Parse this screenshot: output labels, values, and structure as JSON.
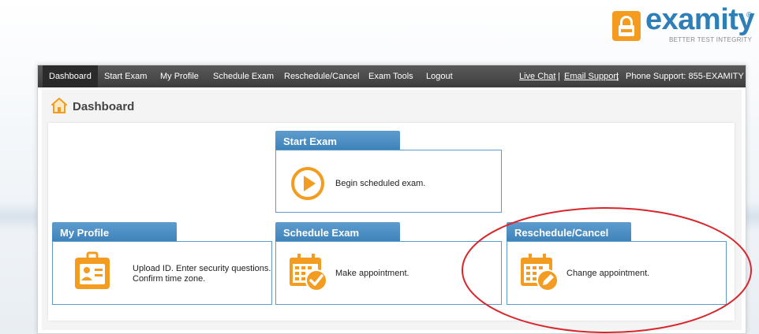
{
  "logo": {
    "name": "examity",
    "reg": "®",
    "tagline": "BETTER TEST INTEGRITY"
  },
  "nav": {
    "items": [
      "Dashboard",
      "Start Exam",
      "My Profile",
      "Schedule Exam",
      "Reschedule/Cancel",
      "Exam Tools",
      "Logout"
    ],
    "active": "Dashboard",
    "live_chat": "Live Chat",
    "email_support": "Email Support",
    "separator": "|",
    "phone": "Phone Support: 855-EXAMITY"
  },
  "page": {
    "title": "Dashboard"
  },
  "cards": {
    "start_exam": {
      "title": "Start Exam",
      "text": "Begin scheduled exam.",
      "icon": "play-icon"
    },
    "my_profile": {
      "title": "My Profile",
      "text_line1": "Upload ID. Enter security questions.",
      "text_line2": "Confirm time zone.",
      "icon": "id-badge-icon"
    },
    "schedule_exam": {
      "title": "Schedule Exam",
      "text": "Make appointment.",
      "icon": "calendar-check-icon"
    },
    "reschedule": {
      "title": "Reschedule/Cancel",
      "text": "Change appointment.",
      "icon": "calendar-edit-icon"
    }
  },
  "colors": {
    "accent_orange": "#f39c1f",
    "brand_blue": "#2e7fb7",
    "tab_blue": "#4a8fc4",
    "highlight_red": "#d8262c",
    "navbar": "#444444"
  }
}
